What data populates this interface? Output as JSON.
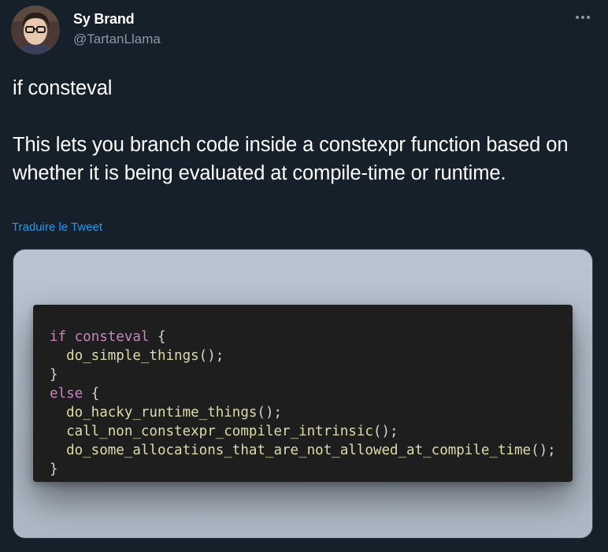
{
  "author": {
    "display_name": "Sy Brand",
    "handle": "@TartanLlama",
    "avatar_icon": "user-avatar"
  },
  "more_icon": "more-horizontal-icon",
  "tweet": {
    "text_line_1": "if consteval",
    "text_line_2": "This lets you branch code inside a constexpr function based on whether it is being evaluated at compile-time or runtime.",
    "translate_link": "Traduire le Tweet"
  },
  "code": {
    "lines": [
      [
        "if",
        " ",
        "consteval",
        " {"
      ],
      [
        "  ",
        "do_simple_things",
        "();"
      ],
      [
        "}"
      ],
      [
        "else",
        " {"
      ],
      [
        "  ",
        "do_hacky_runtime_things",
        "();"
      ],
      [
        "  ",
        "call_non_constexpr_compiler_intrinsic",
        "();"
      ],
      [
        "  ",
        "do_some_allocations_that_are_not_allowed_at_compile_time",
        "();"
      ],
      [
        "}"
      ]
    ]
  },
  "colors": {
    "background": "#15202b",
    "link": "#1d9bf0",
    "muted": "#8899a6",
    "code_bg": "#1e1e1e",
    "keyword": "#c586c0",
    "function": "#dcdcaa"
  }
}
